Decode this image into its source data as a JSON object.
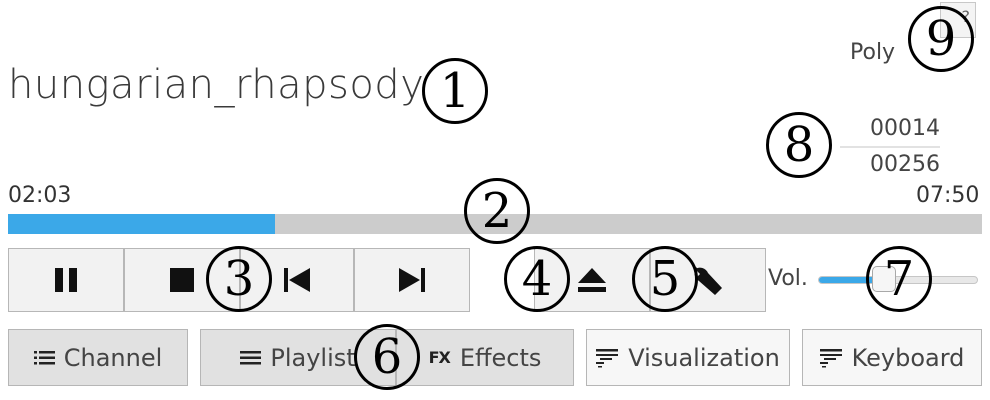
{
  "track": {
    "title": "hungarian_rhapsody"
  },
  "mode": {
    "label": "Poly"
  },
  "help": {
    "label": "?"
  },
  "position": {
    "top": "00014",
    "bottom": "00256"
  },
  "time": {
    "elapsed": "02:03",
    "total": "07:50",
    "progress_fraction": 0.274
  },
  "volume": {
    "label": "Vol.",
    "level_fraction": 0.42
  },
  "tabs": {
    "channel": "Channel",
    "playlist": "Playlist",
    "effects_prefix": "FX",
    "effects": "Effects",
    "visualization": "Visualization",
    "keyboard": "Keyboard"
  },
  "callouts": [
    "1",
    "2",
    "3",
    "4",
    "5",
    "6",
    "7",
    "8",
    "9"
  ],
  "colors": {
    "accent": "#3ba8e8",
    "track_bg": "#cccccc",
    "button_bg": "#f2f2f2",
    "tab_bg": "#e1e1e1"
  },
  "icons": [
    "pause-icon",
    "stop-icon",
    "skip-back-icon",
    "skip-forward-icon",
    "eject-icon",
    "wrench-icon",
    "list-icon",
    "menu-icon",
    "lines-icon"
  ]
}
